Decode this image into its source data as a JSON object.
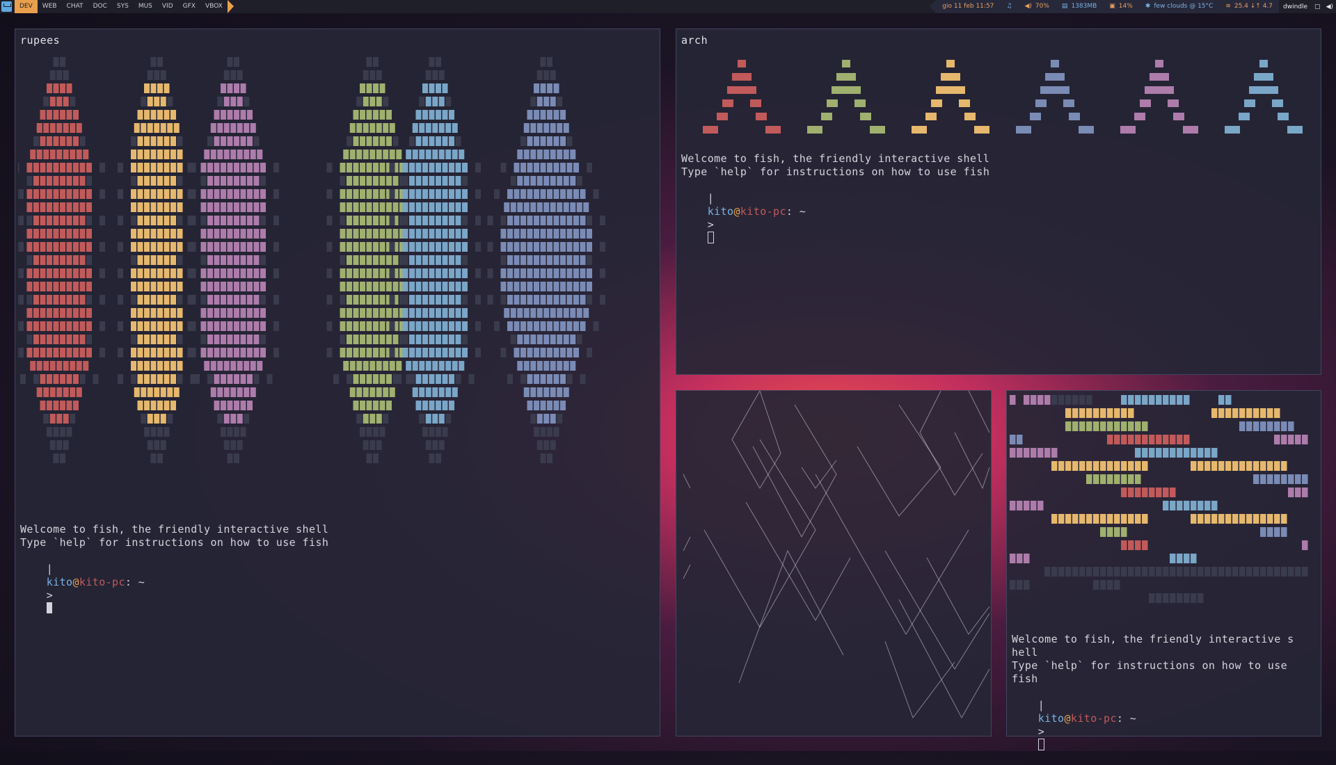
{
  "bar": {
    "workspaces": [
      "DEV",
      "WEB",
      "CHAT",
      "DOC",
      "SYS",
      "MUS",
      "VID",
      "GFX",
      "VBOX"
    ],
    "active_workspace": "DEV",
    "datetime": "gio 11 feb 11:57",
    "volume": "70%",
    "memory": "1383MB",
    "cpu": "14%",
    "weather": "few clouds @ 15°C",
    "network": "25.4 ↓↑ 4.7",
    "layout": "dwindle",
    "icons": [
      "arch-logo-icon",
      "music-note-icon",
      "volume-icon",
      "memory-icon",
      "cpu-icon",
      "weather-icon",
      "wifi-icon",
      "tray-window-icon",
      "tray-speaker-icon"
    ]
  },
  "terminals": {
    "rupees": {
      "title": "rupees",
      "welcome": "Welcome to fish, the friendly interactive shell",
      "help": "Type `help` for instructions on how to use fish",
      "prompt": {
        "bar": "|",
        "user": "kito",
        "at": "@",
        "host": "kito-pc",
        "path": ": ~",
        "arrow": ">"
      }
    },
    "arch": {
      "title": "arch",
      "welcome": "Welcome to fish, the friendly interactive shell",
      "help": "Type `help` for instructions on how to use fish",
      "prompt": {
        "bar": "|",
        "user": "kito",
        "at": "@",
        "host": "kito-pc",
        "path": ": ~",
        "arrow": ">"
      }
    },
    "small": {
      "welcome_1": "Welcome to fish, the friendly interactive s",
      "welcome_2": "hell",
      "help_1": "Type `help` for instructions on how to use",
      "help_2": "fish",
      "prompt": {
        "bar": "|",
        "user": "kito",
        "at": "@",
        "host": "kito-pc",
        "path": ": ~",
        "arrow": ">"
      }
    }
  },
  "colors": {
    "red": "#c15a5a",
    "yellow": "#e6b86d",
    "green": "#9fb06f",
    "blue": "#7aa6c8",
    "slate": "#7a8bb5",
    "pink": "#ad7cab",
    "dark": "#3a3b4d"
  }
}
